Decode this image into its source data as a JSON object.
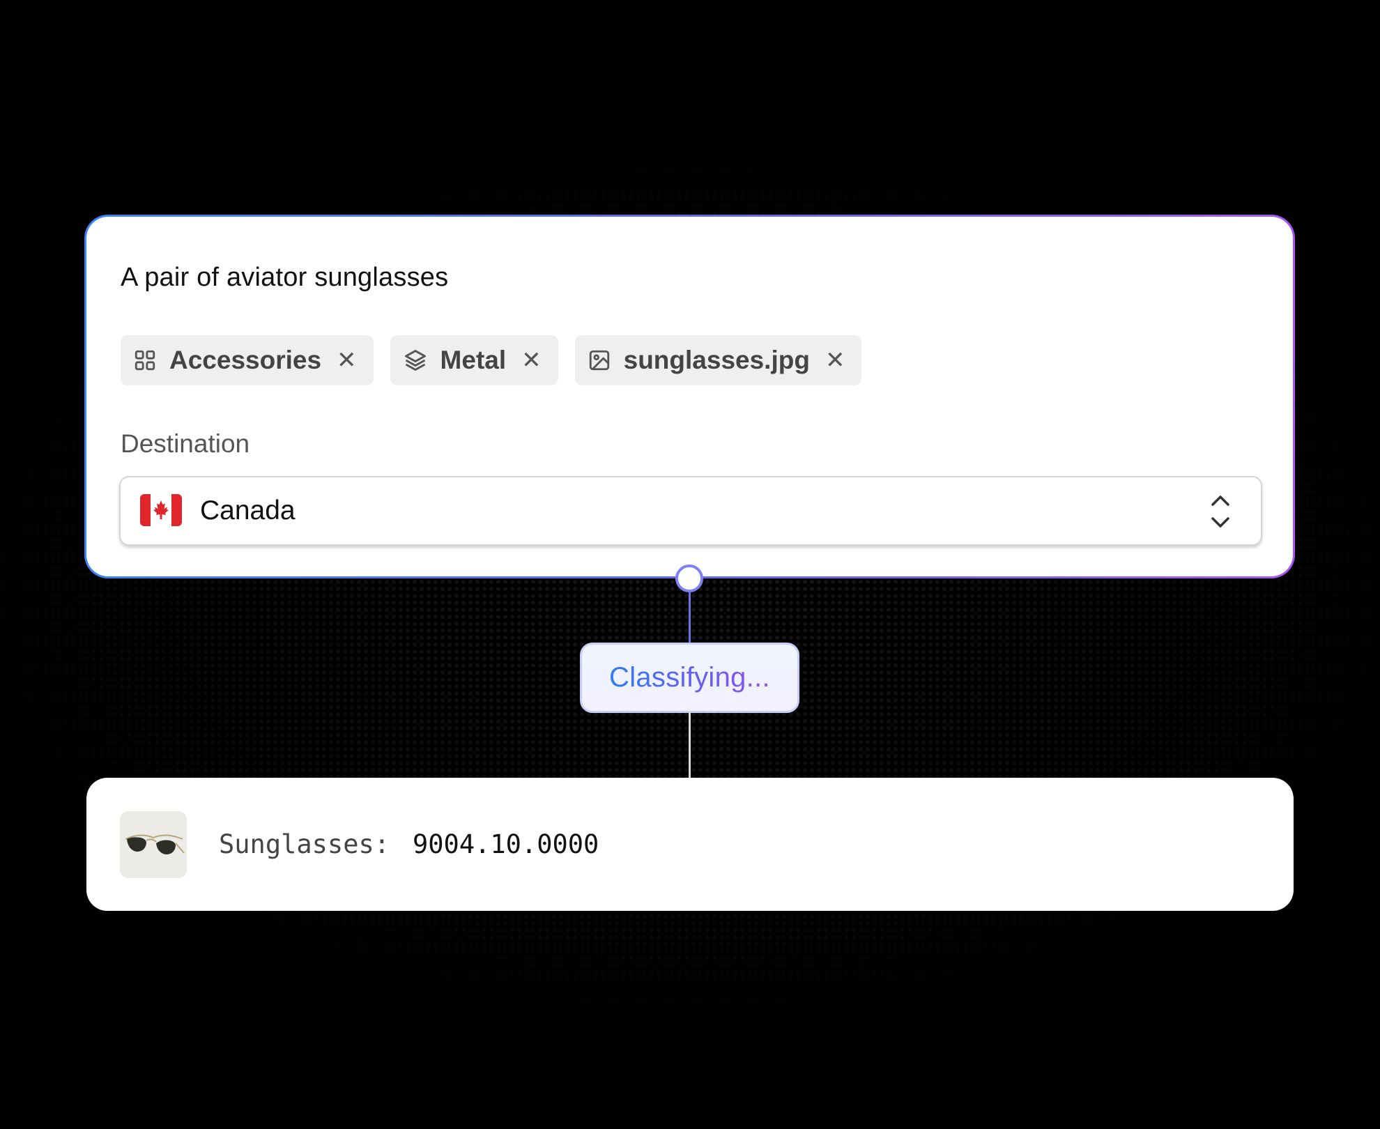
{
  "input_card": {
    "prompt": "A pair of aviator sunglasses",
    "chips": [
      {
        "icon": "grid-icon",
        "label": "Accessories"
      },
      {
        "icon": "layers-icon",
        "label": "Metal"
      },
      {
        "icon": "image-icon",
        "label": "sunglasses.jpg"
      }
    ],
    "destination_label": "Destination",
    "destination": {
      "value": "Canada",
      "flag_icon": "canada-flag-icon"
    }
  },
  "status": {
    "text": "Classifying..."
  },
  "result": {
    "label": "Sunglasses:",
    "code": "9004.10.0000",
    "thumbnail_icon": "sunglasses-thumbnail"
  },
  "colors": {
    "gradient_start": "#3b82f6",
    "gradient_end": "#a855f7",
    "background": "#000000",
    "chip_background": "#efefef"
  }
}
